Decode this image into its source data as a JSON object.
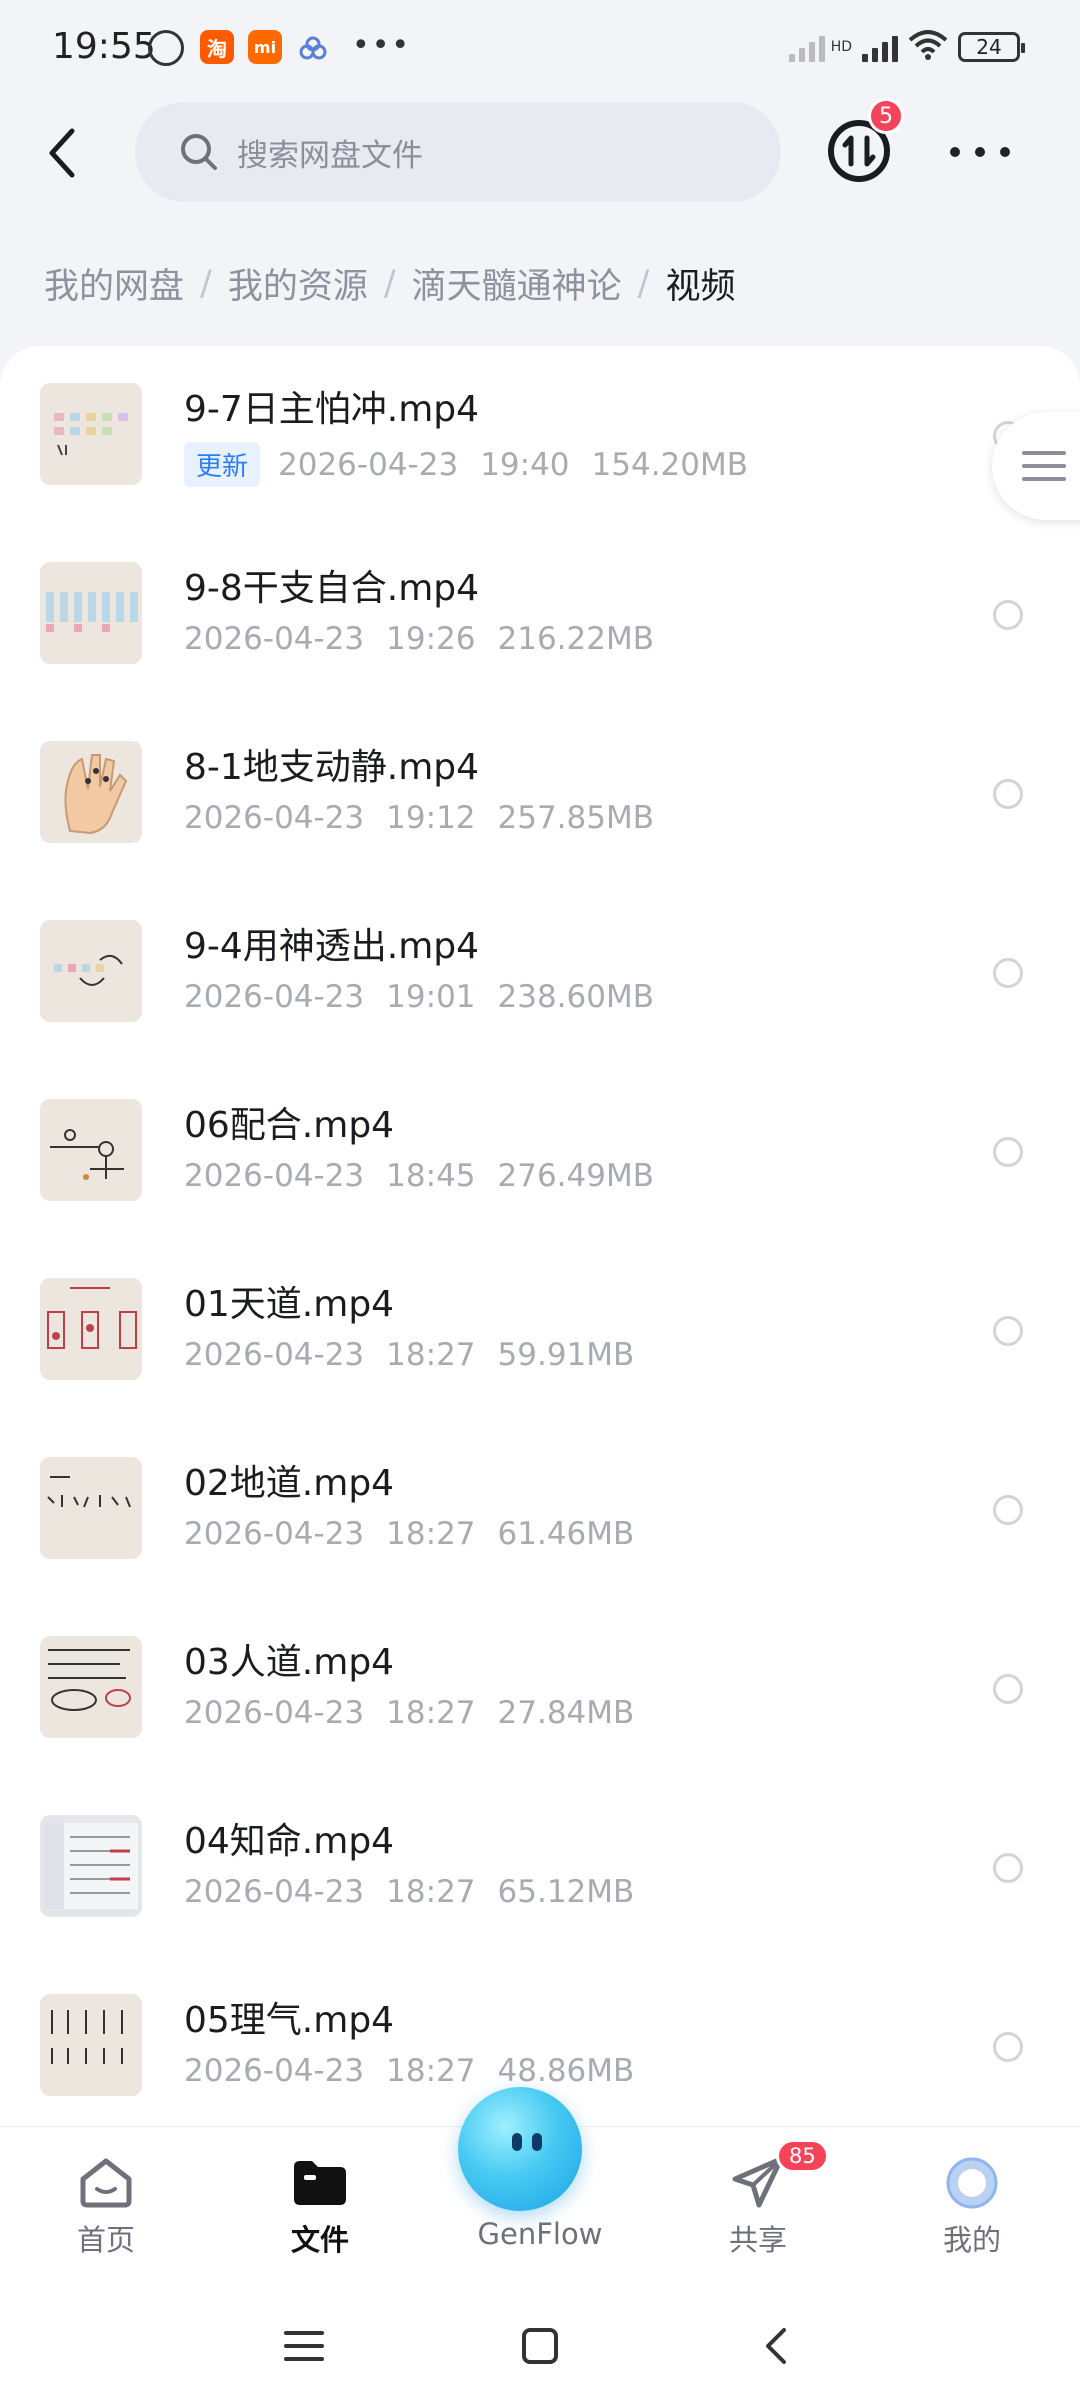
{
  "status_bar": {
    "time": "19:55",
    "battery": "24",
    "network": "HD"
  },
  "header": {
    "search_placeholder": "搜索网盘文件",
    "transfer_badge": "5"
  },
  "breadcrumb": [
    "我的网盘",
    "我的资源",
    "滴天髓通神论",
    "视频"
  ],
  "files": [
    {
      "name": "9-7日主怕冲.mp4",
      "tag": "更新",
      "date": "2026-04-23",
      "time": "19:40",
      "size": "154.20MB"
    },
    {
      "name": "9-8干支自合.mp4",
      "tag": "",
      "date": "2026-04-23",
      "time": "19:26",
      "size": "216.22MB"
    },
    {
      "name": "8-1地支动静.mp4",
      "tag": "",
      "date": "2026-04-23",
      "time": "19:12",
      "size": "257.85MB"
    },
    {
      "name": "9-4用神透出.mp4",
      "tag": "",
      "date": "2026-04-23",
      "time": "19:01",
      "size": "238.60MB"
    },
    {
      "name": "06配合.mp4",
      "tag": "",
      "date": "2026-04-23",
      "time": "18:45",
      "size": "276.49MB"
    },
    {
      "name": "01天道.mp4",
      "tag": "",
      "date": "2026-04-23",
      "time": "18:27",
      "size": "59.91MB"
    },
    {
      "name": "02地道.mp4",
      "tag": "",
      "date": "2026-04-23",
      "time": "18:27",
      "size": "61.46MB"
    },
    {
      "name": "03人道.mp4",
      "tag": "",
      "date": "2026-04-23",
      "time": "18:27",
      "size": "27.84MB"
    },
    {
      "name": "04知命.mp4",
      "tag": "",
      "date": "2026-04-23",
      "time": "18:27",
      "size": "65.12MB"
    },
    {
      "name": "05理气.mp4",
      "tag": "",
      "date": "2026-04-23",
      "time": "18:27",
      "size": "48.86MB"
    }
  ],
  "tabs": [
    {
      "label": "首页",
      "icon": "home-icon"
    },
    {
      "label": "文件",
      "icon": "folder-icon",
      "active": true
    },
    {
      "label": "GenFlow",
      "icon": "genflow-orb-icon"
    },
    {
      "label": "共享",
      "icon": "share-plane-icon",
      "badge": "85"
    },
    {
      "label": "我的",
      "icon": "profile-icon"
    }
  ],
  "colors": {
    "accent": "#2f7df6",
    "badge": "#f5435a",
    "background": "#f3f4f8"
  }
}
